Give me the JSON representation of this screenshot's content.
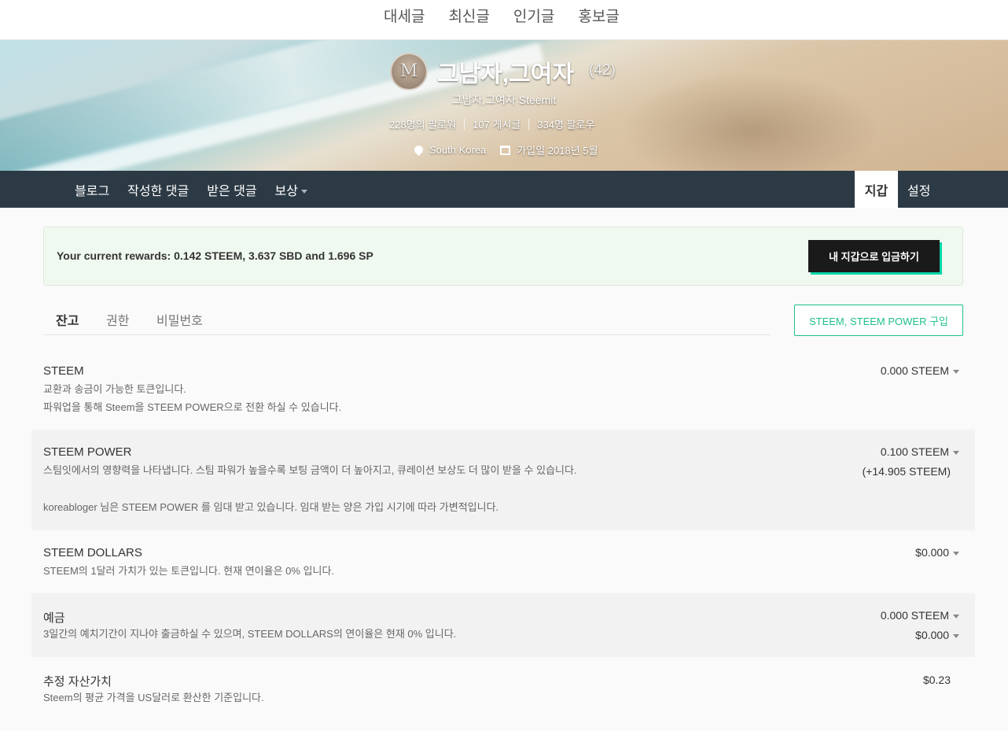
{
  "topnav": {
    "links": [
      "대세글",
      "최신글",
      "인기글",
      "홍보글"
    ]
  },
  "profile": {
    "name": "그남자,그여자",
    "reputation": "(42)",
    "about": "그남자,그여자 Steemit",
    "followers": "228명의 팔로워",
    "posts": "107 게시글",
    "following": "334명 팔로우",
    "location": "South Korea",
    "joined": "가입일 2018년 5월"
  },
  "profile_nav": {
    "blog": "블로그",
    "comments": "작성한 댓글",
    "replies": "받은 댓글",
    "rewards": "보상",
    "wallet": "지갑",
    "settings": "설정"
  },
  "rewards_box": {
    "text": "Your current rewards: 0.142 STEEM, 3.637 SBD and 1.696 SP",
    "claim_label": "내 지갑으로 입금하기"
  },
  "wallet_tabs": {
    "balance": "잔고",
    "permissions": "권한",
    "password": "비밀번호"
  },
  "buy_button": "STEEM, STEEM POWER 구입",
  "balances": {
    "steem": {
      "title": "STEEM",
      "desc1": "교환과 송금이 가능한 토큰입니다.",
      "desc2": "파워업을 통해 Steem을 STEEM POWER으로 전환 하실 수 있습니다.",
      "value": "0.000 STEEM"
    },
    "steem_power": {
      "title": "STEEM POWER",
      "desc1": "스팀잇에서의 영향력을 나타냅니다. 스팀 파워가 높을수록 보팅 금액이 더 높아지고, 큐레이션 보상도 더 많이 받을 수 있습니다.",
      "desc2": "koreabloger 님은 STEEM POWER 를 임대 받고 있습니다. 임대 받는 양은 가입 시기에 따라 가변적입니다.",
      "value": "0.100 STEEM",
      "delegated": "(+14.905 STEEM)"
    },
    "steem_dollars": {
      "title": "STEEM DOLLARS",
      "desc1": "STEEM의 1달러 가치가 있는 토큰입니다. 현재 연이율은 0% 입니다.",
      "value": "$0.000"
    },
    "savings": {
      "title": "예금",
      "desc1": "3일간의 예치기간이 지나야 출금하실 수 있으며, STEEM DOLLARS의 연이율은 현재 0% 입니다.",
      "value_steem": "0.000 STEEM",
      "value_sbd": "$0.000"
    },
    "estimated": {
      "title": "추정 자산가치",
      "desc1": "Steem의 평균 가격을 US달러로 환산한 기준입니다.",
      "value": "$0.23"
    }
  }
}
